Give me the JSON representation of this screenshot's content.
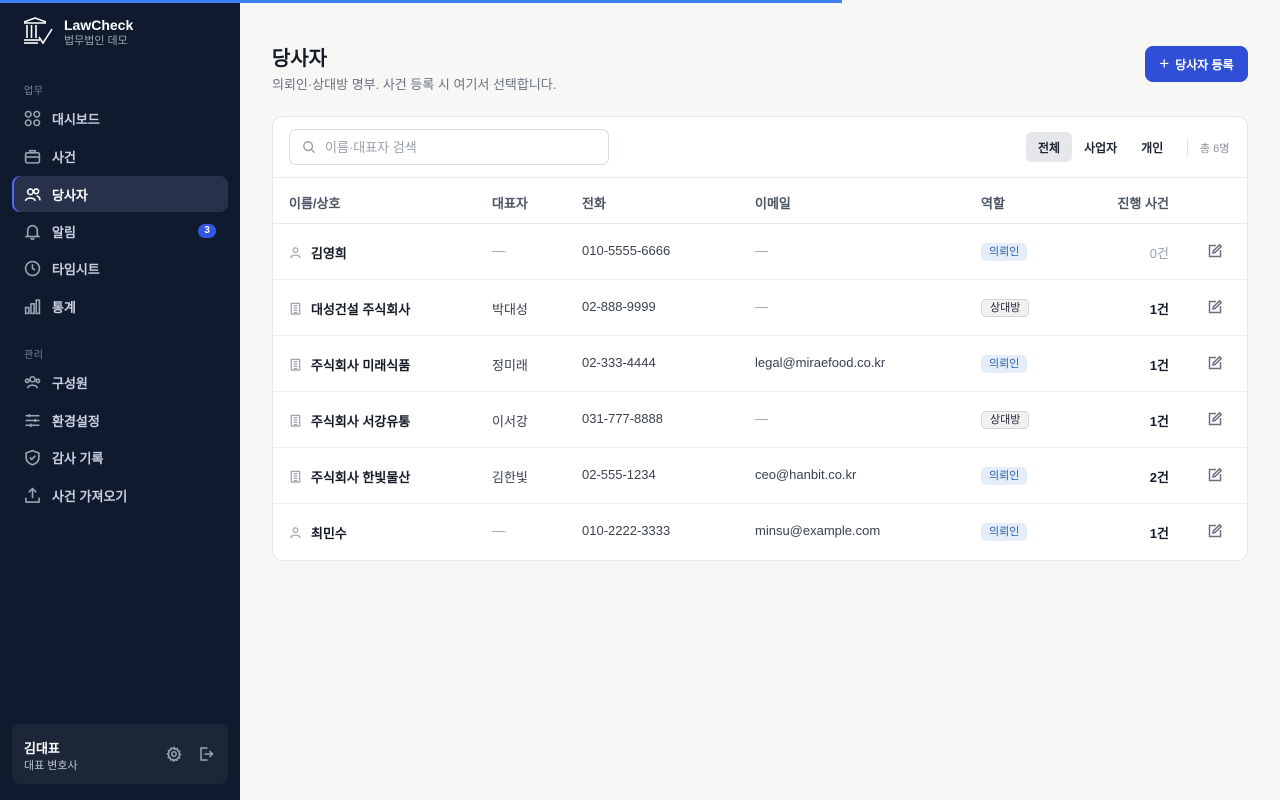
{
  "app": {
    "name": "LawCheck",
    "org": "법무법인 데모"
  },
  "progress": {
    "percent": 65.8
  },
  "sidebar": {
    "sections": [
      {
        "label": "업무"
      },
      {
        "label": "관리"
      }
    ],
    "items": [
      {
        "label": "대시보드",
        "icon": "grid-icon"
      },
      {
        "label": "사건",
        "icon": "briefcase-icon"
      },
      {
        "label": "당사자",
        "icon": "users-icon",
        "active": true
      },
      {
        "label": "알림",
        "icon": "bell-icon",
        "badge": "3"
      },
      {
        "label": "타임시트",
        "icon": "clock-icon"
      },
      {
        "label": "통계",
        "icon": "bar-chart-icon"
      },
      {
        "label": "구성원",
        "icon": "team-icon"
      },
      {
        "label": "환경설정",
        "icon": "sliders-icon"
      },
      {
        "label": "감사 기록",
        "icon": "shield-icon"
      },
      {
        "label": "사건 가져오기",
        "icon": "upload-icon"
      }
    ],
    "user": {
      "name": "김대표",
      "role": "대표 변호사"
    }
  },
  "page": {
    "title": "당사자",
    "description": "의뢰인·상대방 명부. 사건 등록 시 여기서 선택합니다.",
    "add_button": "당사자 등록"
  },
  "toolbar": {
    "search_placeholder": "이름·대표자 검색",
    "filters": [
      "전체",
      "사업자",
      "개인"
    ],
    "active_filter": "전체",
    "count": "총 6명"
  },
  "table": {
    "columns": [
      "이름/상호",
      "대표자",
      "전화",
      "이메일",
      "역할",
      "진행 사건"
    ],
    "rows": [
      {
        "type": "person",
        "name": "김영희",
        "rep": "—",
        "phone": "010-5555-6666",
        "email": "—",
        "role": "의뢰인",
        "cases": "0건"
      },
      {
        "type": "company",
        "name": "대성건설 주식회사",
        "rep": "박대성",
        "phone": "02-888-9999",
        "email": "—",
        "role": "상대방",
        "cases": "1건"
      },
      {
        "type": "company",
        "name": "주식회사 미래식품",
        "rep": "정미래",
        "phone": "02-333-4444",
        "email": "legal@miraefood.co.kr",
        "role": "의뢰인",
        "cases": "1건"
      },
      {
        "type": "company",
        "name": "주식회사 서강유통",
        "rep": "이서강",
        "phone": "031-777-8888",
        "email": "—",
        "role": "상대방",
        "cases": "1건"
      },
      {
        "type": "company",
        "name": "주식회사 한빛물산",
        "rep": "김한빛",
        "phone": "02-555-1234",
        "email": "ceo@hanbit.co.kr",
        "role": "의뢰인",
        "cases": "2건"
      },
      {
        "type": "person",
        "name": "최민수",
        "rep": "—",
        "phone": "010-2222-3333",
        "email": "minsu@example.com",
        "role": "의뢰인",
        "cases": "1건"
      }
    ]
  },
  "colors": {
    "accent": "#2f4fd6",
    "sidebar": "#0f1a2e",
    "progress": "#3b82f6"
  }
}
